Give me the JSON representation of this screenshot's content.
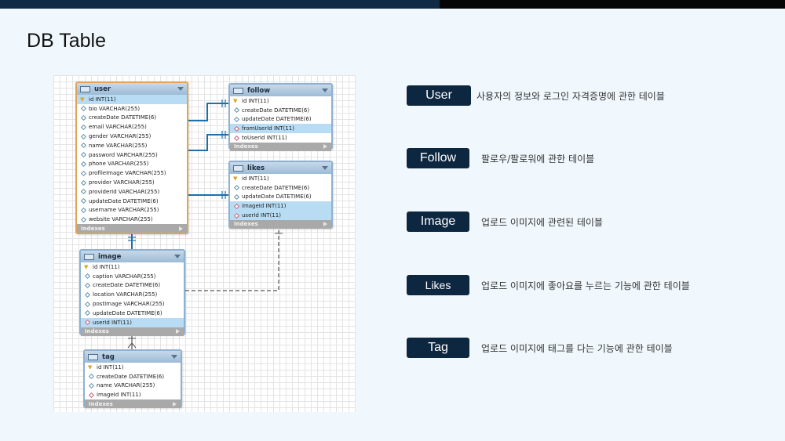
{
  "slide": {
    "title": "DB Table"
  },
  "diagram": {
    "tables": [
      {
        "key": "user",
        "name": "user",
        "columns": [
          {
            "text": "id INT(11)",
            "kind": "pk"
          },
          {
            "text": "bio VARCHAR(255)",
            "kind": "col"
          },
          {
            "text": "createDate DATETIME(6)",
            "kind": "col"
          },
          {
            "text": "email VARCHAR(255)",
            "kind": "col"
          },
          {
            "text": "gender VARCHAR(255)",
            "kind": "col"
          },
          {
            "text": "name VARCHAR(255)",
            "kind": "col"
          },
          {
            "text": "password VARCHAR(255)",
            "kind": "col"
          },
          {
            "text": "phone VARCHAR(255)",
            "kind": "col"
          },
          {
            "text": "profileImage VARCHAR(255)",
            "kind": "col"
          },
          {
            "text": "provider VARCHAR(255)",
            "kind": "col"
          },
          {
            "text": "providerId VARCHAR(255)",
            "kind": "col"
          },
          {
            "text": "updateDate DATETIME(6)",
            "kind": "col"
          },
          {
            "text": "username VARCHAR(255)",
            "kind": "col"
          },
          {
            "text": "website VARCHAR(255)",
            "kind": "col"
          }
        ],
        "footer": "Indexes"
      },
      {
        "key": "follow",
        "name": "follow",
        "columns": [
          {
            "text": "id INT(11)",
            "kind": "pk"
          },
          {
            "text": "createDate DATETIME(6)",
            "kind": "col"
          },
          {
            "text": "updateDate DATETIME(6)",
            "kind": "col"
          },
          {
            "text": "fromUserId INT(11)",
            "kind": "fk"
          },
          {
            "text": "toUserId INT(11)",
            "kind": "fk"
          }
        ],
        "footer": "Indexes"
      },
      {
        "key": "likes",
        "name": "likes",
        "columns": [
          {
            "text": "id INT(11)",
            "kind": "pk"
          },
          {
            "text": "createDate DATETIME(6)",
            "kind": "col"
          },
          {
            "text": "updateDate DATETIME(6)",
            "kind": "col"
          },
          {
            "text": "imageId INT(11)",
            "kind": "fk"
          },
          {
            "text": "userId INT(11)",
            "kind": "fk"
          }
        ],
        "footer": "Indexes"
      },
      {
        "key": "image",
        "name": "image",
        "columns": [
          {
            "text": "id INT(11)",
            "kind": "pk"
          },
          {
            "text": "caption VARCHAR(255)",
            "kind": "col"
          },
          {
            "text": "createDate DATETIME(6)",
            "kind": "col"
          },
          {
            "text": "location VARCHAR(255)",
            "kind": "col"
          },
          {
            "text": "postImage VARCHAR(255)",
            "kind": "col"
          },
          {
            "text": "updateDate DATETIME(6)",
            "kind": "col"
          },
          {
            "text": "userId INT(11)",
            "kind": "fk"
          }
        ],
        "footer": "Indexes"
      },
      {
        "key": "tag",
        "name": "tag",
        "columns": [
          {
            "text": "id INT(11)",
            "kind": "pk"
          },
          {
            "text": "createDate DATETIME(6)",
            "kind": "col"
          },
          {
            "text": "name VARCHAR(255)",
            "kind": "col"
          },
          {
            "text": "imageId INT(11)",
            "kind": "fk"
          }
        ],
        "footer": "Indexes"
      }
    ]
  },
  "descriptions": [
    {
      "label": "User",
      "text": "사용자의 정보와 로그인 자격증명에 관한 테이블"
    },
    {
      "label": "Follow",
      "text": "팔로우/팔로워에 관한 테이블"
    },
    {
      "label": "Image",
      "text": "업로드 이미지에 관련된 테이블"
    },
    {
      "label": "Likes",
      "text": "업로드 이미지에 좋아요를 누르는 기능에 관한 테이블"
    },
    {
      "label": "Tag",
      "text": "업로드 이미지에 태그를 다는 기능에 관한 테이블"
    }
  ],
  "colors": {
    "badge": "#0e2740",
    "topbar_dark": "#0f2a44",
    "topbar_black": "#050505",
    "relation_line": "#1f6fa8",
    "highlight_row": "#b7dcf3"
  }
}
